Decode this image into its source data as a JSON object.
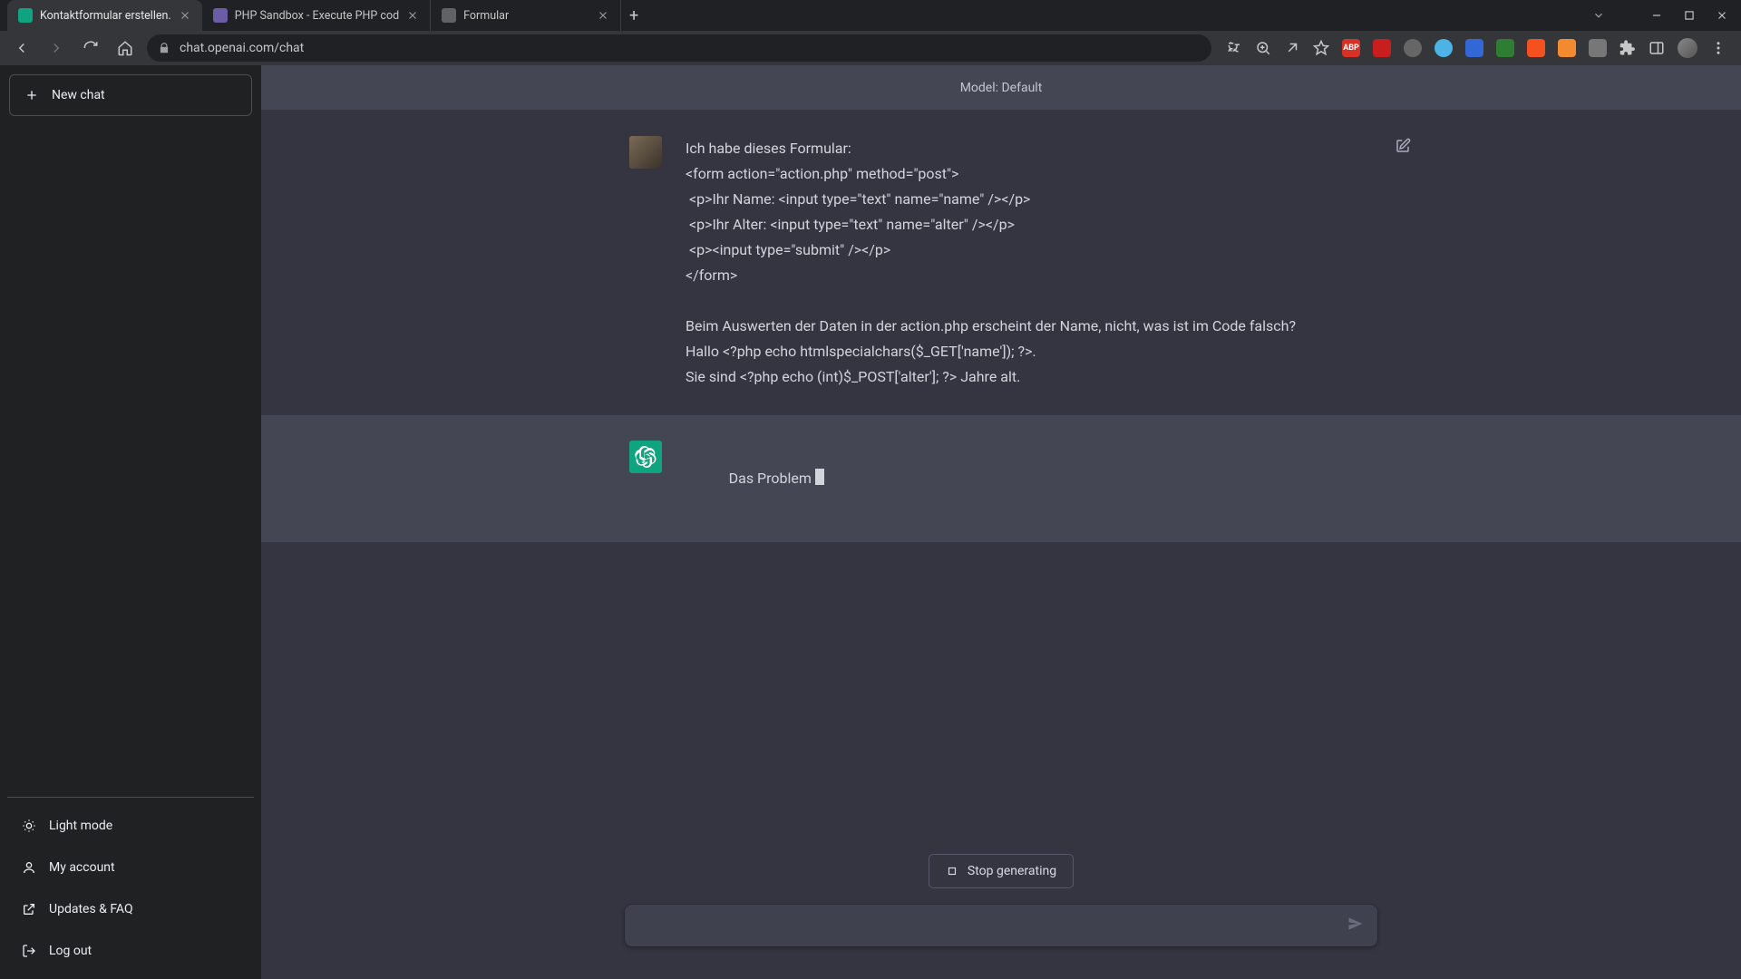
{
  "browser": {
    "tabs": [
      {
        "title": "Kontaktformular erstellen.",
        "favicon_color": "fav-green",
        "active": true
      },
      {
        "title": "PHP Sandbox - Execute PHP cod",
        "favicon_color": "fav-purple",
        "active": false
      },
      {
        "title": "Formular",
        "favicon_color": "fav-grey",
        "active": false
      }
    ],
    "url": "chat.openai.com/chat",
    "ext_colors": [
      "#d93025",
      "#c81e1e",
      "#666",
      "#4cb3e6",
      "#3367d6",
      "#2e7d32",
      "#f4511e",
      "#f28b30",
      "#777",
      "#555"
    ]
  },
  "sidebar": {
    "new_chat": "New chat",
    "items": [
      {
        "label": "Light mode",
        "icon": "sun"
      },
      {
        "label": "My account",
        "icon": "user"
      },
      {
        "label": "Updates & FAQ",
        "icon": "link"
      },
      {
        "label": "Log out",
        "icon": "logout"
      }
    ]
  },
  "header": {
    "model_line": "Model: Default"
  },
  "conversation": {
    "user_message": "Ich habe dieses Formular:\n<form action=\"action.php\" method=\"post\">\n <p>Ihr Name: <input type=\"text\" name=\"name\" /></p>\n <p>Ihr Alter: <input type=\"text\" name=\"alter\" /></p>\n <p><input type=\"submit\" /></p>\n</form>\n\nBeim Auswerten der Daten in der action.php erscheint der Name, nicht, was ist im Code falsch?\nHallo <?php echo htmlspecialchars($_GET['name']); ?>.\nSie sind <?php echo (int)$_POST['alter']; ?> Jahre alt.",
    "assistant_partial": "Das Problem"
  },
  "controls": {
    "stop_label": "Stop generating",
    "input_placeholder": ""
  }
}
